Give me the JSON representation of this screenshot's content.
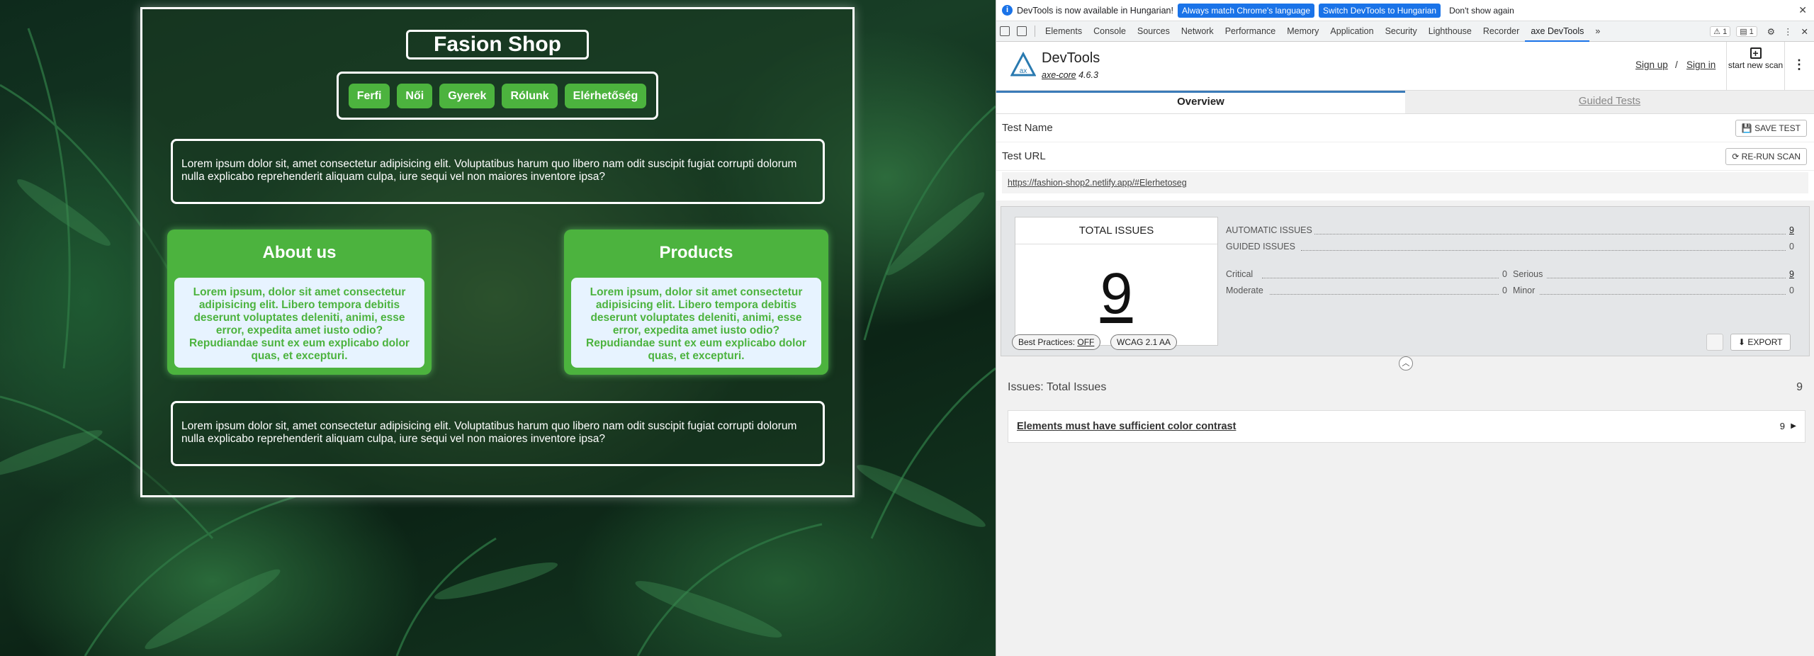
{
  "site": {
    "title": "Fasion Shop",
    "nav": [
      "Ferfi",
      "Női",
      "Gyerek",
      "Rólunk",
      "Elérhetőség"
    ],
    "intro_text": "Lorem ipsum dolor sit, amet consectetur adipisicing elit. Voluptatibus harum quo libero nam odit suscipit fugiat corrupti dolorum nulla explicabo reprehenderit aliquam culpa, iure sequi vel non maiores inventore ipsa?",
    "cards": [
      {
        "title": "About us",
        "text": "Lorem ipsum, dolor sit amet consectetur adipisicing elit. Libero tempora debitis deserunt voluptates deleniti, animi, esse error, expedita amet iusto odio? Repudiandae sunt ex eum explicabo dolor quas, et excepturi."
      },
      {
        "title": "Products",
        "text": "Lorem ipsum, dolor sit amet consectetur adipisicing elit. Libero tempora debitis deserunt voluptates deleniti, animi, esse error, expedita amet iusto odio? Repudiandae sunt ex eum explicabo dolor quas, et excepturi."
      }
    ],
    "footer_text": "Lorem ipsum dolor sit, amet consectetur adipisicing elit. Voluptatibus harum quo libero nam odit suscipit fugiat corrupti dolorum nulla explicabo reprehenderit aliquam culpa, iure sequi vel non maiores inventore ipsa?"
  },
  "devtools": {
    "infobar": {
      "message": "DevTools is now available in Hungarian!",
      "btn_match": "Always match Chrome's language",
      "btn_switch": "Switch DevTools to Hungarian",
      "btn_dismiss": "Don't show again"
    },
    "tabs": [
      "Elements",
      "Console",
      "Sources",
      "Network",
      "Performance",
      "Memory",
      "Application",
      "Security",
      "Lighthouse",
      "Recorder",
      "axe DevTools"
    ],
    "warn_count": "1",
    "msg_count": "1",
    "axe": {
      "title": "DevTools",
      "core_name": "axe-core",
      "core_version": "4.6.3",
      "sign_up": "Sign up",
      "sep": "/",
      "sign_in": "Sign in",
      "new_scan": "start new scan",
      "tab_overview": "Overview",
      "tab_guided": "Guided Tests",
      "test_name_label": "Test Name",
      "save_test": "SAVE TEST",
      "test_url_label": "Test URL",
      "rerun": "RE-RUN SCAN",
      "url": "https://fashion-shop2.netlify.app/#Elerhetoseg",
      "total_label": "TOTAL ISSUES",
      "total": "9",
      "automatic_label": "AUTOMATIC ISSUES",
      "automatic": "9",
      "guided_label": "GUIDED ISSUES",
      "guided": "0",
      "critical_label": "Critical",
      "critical": "0",
      "serious_label": "Serious",
      "serious": "9",
      "moderate_label": "Moderate",
      "moderate": "0",
      "minor_label": "Minor",
      "minor": "0",
      "best_practices": "Best Practices:",
      "best_practices_state": "OFF",
      "wcag": "WCAG 2.1 AA",
      "export": "EXPORT",
      "issues_heading": "Issues: Total Issues",
      "issues_count": "9",
      "issue_title": "Elements must have sufficient color contrast",
      "issue_count": "9"
    }
  }
}
